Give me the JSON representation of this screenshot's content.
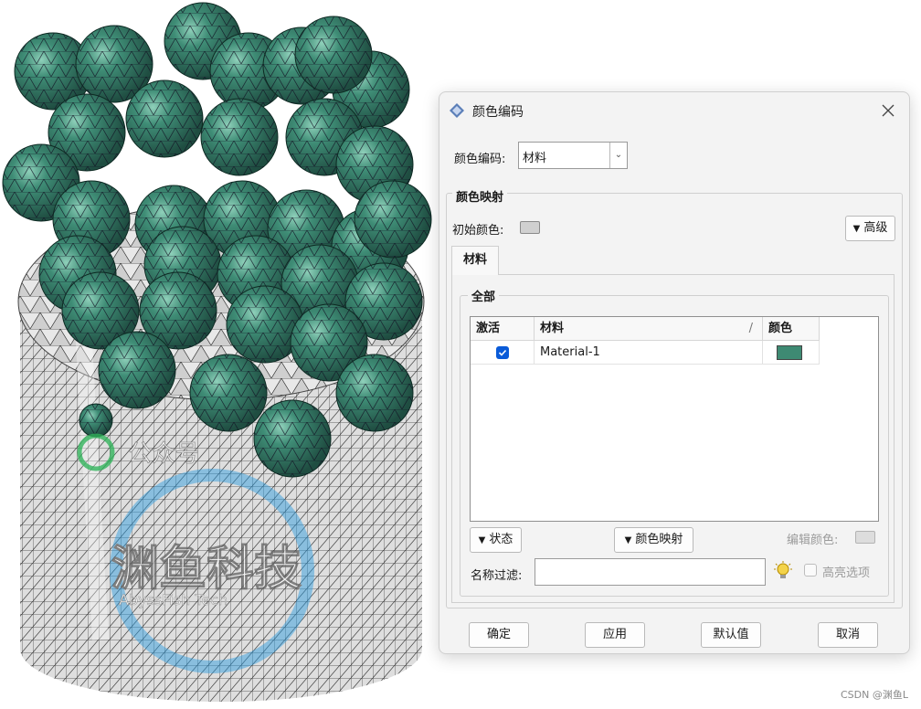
{
  "dialog": {
    "title": "颜色编码",
    "color_code_label": "颜色编码:",
    "color_code_value": "材料",
    "color_map_group": "颜色映射",
    "initial_color_label": "初始颜色:",
    "advanced_button": "高级",
    "tab_material": "材料",
    "all_group": "全部",
    "table": {
      "headers": [
        "激活",
        "材料",
        "颜色"
      ],
      "sort_marker": "/",
      "rows": [
        {
          "active": true,
          "material": "Material-1",
          "color": "#3e8a73"
        }
      ]
    },
    "status_button": "状态",
    "color_map_button": "颜色映射",
    "edit_color_label": "编辑颜色:",
    "name_filter_label": "名称过滤:",
    "name_filter_value": "",
    "highlight_label": "高亮选项",
    "ok_button": "确定",
    "apply_button": "应用",
    "default_button": "默认值",
    "cancel_button": "取消"
  },
  "watermark": {
    "wechat_label": "公众号",
    "brand_cn": "渊鱼科技",
    "brand_en": "AbyssFish Tech"
  },
  "footer_credit": "CSDN @渊鱼L",
  "colors": {
    "sphere": "#2f6e5c",
    "cylinder": "#d9d9d9",
    "accent": "#0a5bd8"
  }
}
